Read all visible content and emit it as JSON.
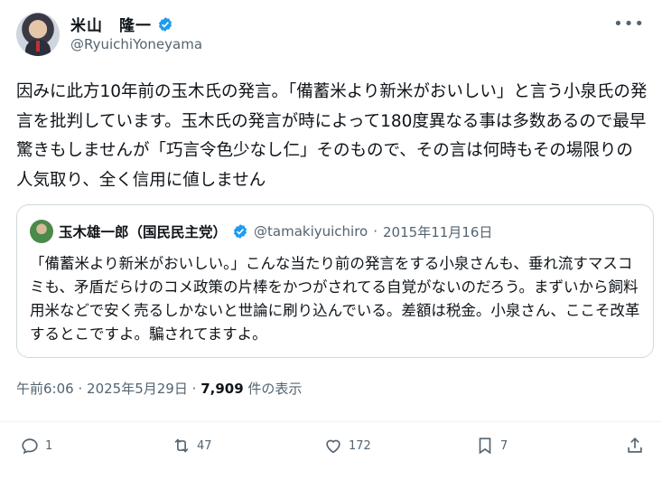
{
  "author": {
    "name": "米山　隆一",
    "handle": "@RyuichiYoneyama"
  },
  "post": {
    "text": "因みに此方10年前の玉木氏の発言。「備蓄米より新米がおいしい」と言う小泉氏の発言を批判しています。玉木氏の発言が時によって180度異なる事は多数あるので最早驚きもしませんが「巧言令色少なし仁」そのもので、その言は何時もその場限りの人気取り、全く信用に値しません"
  },
  "quote": {
    "name": "玉木雄一郎（国民民主党）",
    "handle": "@tamakiyuichiro",
    "separator": "·",
    "date": "2015年11月16日",
    "text": "「備蓄米より新米がおいしい。」こんな当たり前の発言をする小泉さんも、垂れ流すマスコミも、矛盾だらけのコメ政策の片棒をかつがされてる自覚がないのだろう。まずいから飼料用米などで安く売るしかないと世論に刷り込んでいる。差額は税金。小泉さん、ここそ改革するとこですよ。騙されてますよ。"
  },
  "meta": {
    "time": "午前6:06",
    "sep1": "·",
    "date": "2025年5月29日",
    "sep2": "·",
    "views": "7,909",
    "views_label": "件の表示"
  },
  "actions": {
    "reply_count": "1",
    "repost_count": "47",
    "like_count": "172",
    "bookmark_count": "7"
  },
  "icons": {
    "verified": "verified-badge-icon",
    "more": "more-icon",
    "reply": "reply-icon",
    "repost": "repost-icon",
    "like": "heart-icon",
    "bookmark": "bookmark-icon",
    "share": "share-icon"
  },
  "colors": {
    "verified": "#1d9bf0",
    "muted": "#536471",
    "border": "#cfd9de"
  }
}
